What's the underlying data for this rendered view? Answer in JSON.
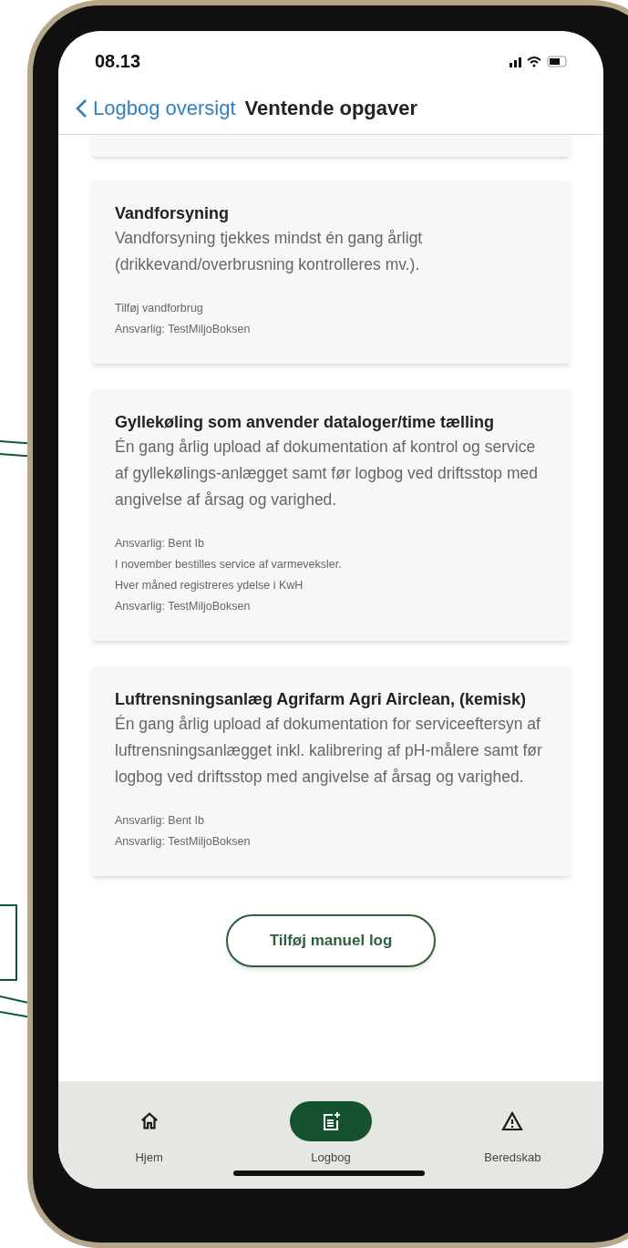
{
  "status_bar": {
    "time": "08.13"
  },
  "header": {
    "back_label": "Logbog oversigt",
    "title": "Ventende opgaver"
  },
  "tasks": [
    {
      "title": "Vandforsyning",
      "description": "Vandforsyning tjekkes mindst én gang årligt (drikkevand/overbrusning kontrolleres mv.).",
      "notes": [
        "Tilføj vandforbrug",
        "Ansvarlig: TestMiljoBoksen"
      ]
    },
    {
      "title": "Gyllekøling som anvender dataloger/time tælling",
      "description": "Én gang årlig upload af dokumentation af kontrol og service af gyllekølings-anlægget samt før logbog ved driftsstop med angivelse af årsag og varighed.",
      "notes": [
        "Ansvarlig: Bent Ib",
        "I november bestilles service af varmeveksler.",
        "Hver måned registreres ydelse i KwH",
        "Ansvarlig: TestMiljoBoksen"
      ]
    },
    {
      "title": "Luftrensningsanlæg Agrifarm Agri Airclean, (kemisk)",
      "description": "Én gang årlig upload af dokumentation for serviceeftersyn af luftrensningsanlægget inkl. kalibrering af pH-målere samt før logbog ved driftsstop med angivelse af årsag og varighed.",
      "notes": [
        "Ansvarlig: Bent Ib",
        "Ansvarlig: TestMiljoBoksen"
      ]
    }
  ],
  "add_button": "Tilføj manuel log",
  "tab_bar": [
    {
      "label": "Hjem",
      "selected": false
    },
    {
      "label": "Logbog",
      "selected": true
    },
    {
      "label": "Beredskab",
      "selected": false
    }
  ]
}
